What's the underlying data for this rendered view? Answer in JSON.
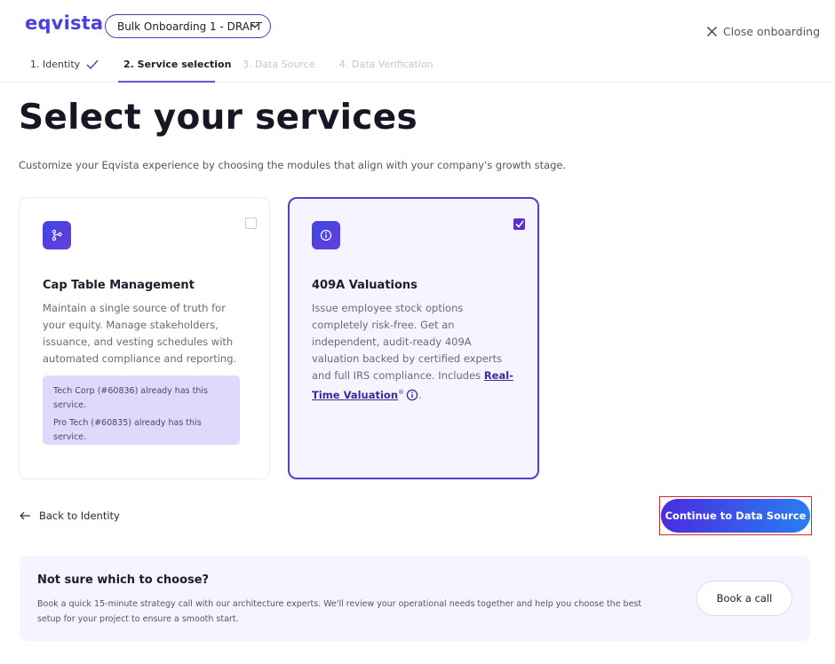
{
  "header": {
    "logo": "eqvista",
    "onboarding_select": "Bulk Onboarding 1 - DRAFT",
    "close_label": "Close onboarding"
  },
  "steps": [
    {
      "label": "1. Identity",
      "state": "done"
    },
    {
      "label": "2. Service selection",
      "state": "active"
    },
    {
      "label": "3. Data Source",
      "state": "upcoming"
    },
    {
      "label": "4. Data Verification",
      "state": "upcoming"
    }
  ],
  "page": {
    "title": "Select your services",
    "subtitle": "Customize your Eqvista experience by choosing the modules that align with your company's growth stage."
  },
  "cards": {
    "cap_table": {
      "title": "Cap Table Management",
      "description": "Maintain a single source of truth for your equity. Manage stakeholders, issuance, and vesting schedules with automated compliance and reporting.",
      "checked": false,
      "notices": [
        "Tech Corp (#60836) already has this service.",
        "Pro Tech (#60835) already has this service."
      ]
    },
    "valuation": {
      "title": "409A Valuations",
      "description_prefix": "Issue employee stock options completely risk-free. Get an independent, audit-ready 409A valuation backed by certified experts and full IRS compliance. Includes ",
      "link_text": "Real-Time Valuation",
      "superscript": "®",
      "description_suffix": ".",
      "checked": true
    }
  },
  "nav": {
    "back_label": "Back to Identity",
    "continue_label": "Continue to Data Source"
  },
  "help": {
    "title": "Not sure which to choose?",
    "description": "Book a quick 15-minute strategy call with our architecture experts. We'll review your operational needs together and help you choose the best setup for your project to ensure a smooth start.",
    "button_label": "Book a call"
  },
  "colors": {
    "brand": "#4a3fe0",
    "accent": "#5a3cc8",
    "notice_bg": "#e1d9fb",
    "highlight": "#d4262c"
  }
}
